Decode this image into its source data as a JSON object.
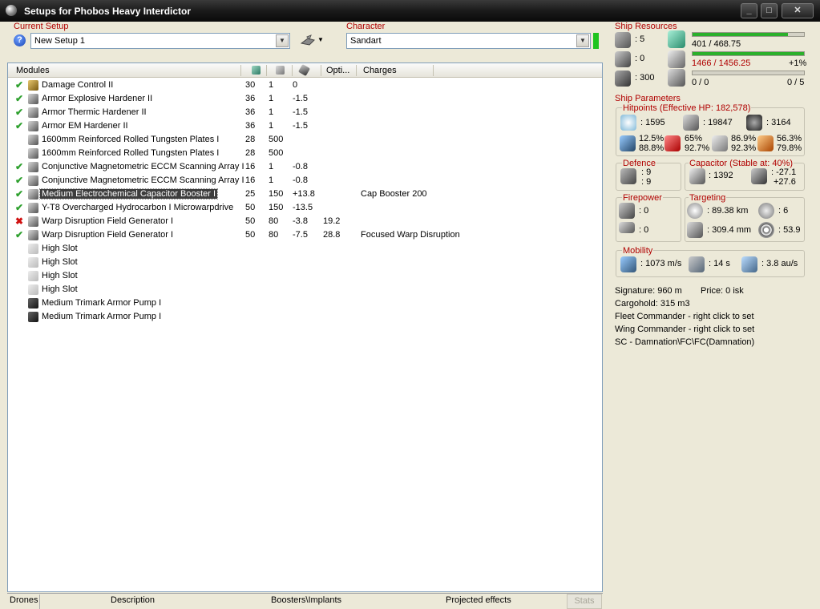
{
  "window": {
    "title": "Setups for Phobos Heavy Interdictor",
    "min_label": "_",
    "max_label": "□",
    "close_label": "✕"
  },
  "setup": {
    "label": "Current Setup",
    "value": "New Setup 1",
    "help_label": "?",
    "tool_arrow": "▼"
  },
  "character": {
    "label": "Character",
    "value": "Sandart",
    "status_color": "#1fc41f"
  },
  "modules_header": {
    "modules": "Modules",
    "opti": "Opti...",
    "charges": "Charges"
  },
  "modules": [
    {
      "status": "✔",
      "name": "Damage Control II",
      "cpu": "30",
      "pg": "1",
      "cap": "0",
      "opti": "",
      "charge": ""
    },
    {
      "status": "✔",
      "name": "Armor Explosive Hardener II",
      "cpu": "36",
      "pg": "1",
      "cap": "-1.5",
      "opti": "",
      "charge": ""
    },
    {
      "status": "✔",
      "name": "Armor Thermic Hardener II",
      "cpu": "36",
      "pg": "1",
      "cap": "-1.5",
      "opti": "",
      "charge": ""
    },
    {
      "status": "✔",
      "name": "Armor EM Hardener II",
      "cpu": "36",
      "pg": "1",
      "cap": "-1.5",
      "opti": "",
      "charge": ""
    },
    {
      "status": "",
      "name": "1600mm Reinforced Rolled Tungsten Plates I",
      "cpu": "28",
      "pg": "500",
      "cap": "",
      "opti": "",
      "charge": ""
    },
    {
      "status": "",
      "name": "1600mm Reinforced Rolled Tungsten Plates I",
      "cpu": "28",
      "pg": "500",
      "cap": "",
      "opti": "",
      "charge": ""
    },
    {
      "status": "✔",
      "name": "Conjunctive Magnetometric ECCM Scanning Array I",
      "cpu": "16",
      "pg": "1",
      "cap": "-0.8",
      "opti": "",
      "charge": ""
    },
    {
      "status": "✔",
      "name": "Conjunctive Magnetometric ECCM Scanning Array I",
      "cpu": "16",
      "pg": "1",
      "cap": "-0.8",
      "opti": "",
      "charge": ""
    },
    {
      "status": "✔",
      "name": "Medium Electrochemical Capacitor Booster I",
      "cpu": "25",
      "pg": "150",
      "cap": "+13.8",
      "opti": "",
      "charge": "Cap Booster 200"
    },
    {
      "status": "✔",
      "name": "Y-T8 Overcharged Hydrocarbon I Microwarpdrive",
      "cpu": "50",
      "pg": "150",
      "cap": "-13.5",
      "opti": "",
      "charge": ""
    },
    {
      "status": "✖",
      "name": "Warp Disruption Field Generator I",
      "cpu": "50",
      "pg": "80",
      "cap": "-3.8",
      "opti": "19.2",
      "charge": ""
    },
    {
      "status": "✔",
      "name": "Warp Disruption Field Generator I",
      "cpu": "50",
      "pg": "80",
      "cap": "-7.5",
      "opti": "28.8",
      "charge": "Focused Warp Disruption"
    },
    {
      "status": "",
      "name": "High Slot",
      "cpu": "",
      "pg": "",
      "cap": "",
      "opti": "",
      "charge": ""
    },
    {
      "status": "",
      "name": "High Slot",
      "cpu": "",
      "pg": "",
      "cap": "",
      "opti": "",
      "charge": ""
    },
    {
      "status": "",
      "name": "High Slot",
      "cpu": "",
      "pg": "",
      "cap": "",
      "opti": "",
      "charge": ""
    },
    {
      "status": "",
      "name": "High Slot",
      "cpu": "",
      "pg": "",
      "cap": "",
      "opti": "",
      "charge": ""
    },
    {
      "status": "",
      "name": "Medium Trimark Armor Pump I",
      "cpu": "",
      "pg": "",
      "cap": "",
      "opti": "",
      "charge": ""
    },
    {
      "status": "",
      "name": "Medium Trimark Armor Pump I",
      "cpu": "",
      "pg": "",
      "cap": "",
      "opti": "",
      "charge": ""
    }
  ],
  "bottom_tabs": {
    "drones": "Drones",
    "description": "Description",
    "boosters": "Boosters\\Implants",
    "projected": "Projected effects",
    "stats": "Stats"
  },
  "resources": {
    "label": "Ship Resources",
    "turret": ": 5",
    "launcher": ": 0",
    "calibration": ": 300",
    "cpu": "401 / 468.75",
    "cpu_fill": 0.855,
    "powergrid": "1466 / 1456.25",
    "powergrid_pct": "+1%",
    "powergrid_fill": 1.0,
    "drone_bay": "0 / 0",
    "drone_count": "0 / 5",
    "drone_fill": 0
  },
  "params": {
    "label": "Ship Parameters",
    "hitpoints_label": "Hitpoints (Effective HP: 182,578)",
    "shield_hp": ": 1595",
    "armor_hp": ": 19847",
    "structure_hp": ": 3164",
    "res_em_a": "12.5%",
    "res_em_b": "88.8%",
    "res_therm_a": "65%",
    "res_therm_b": "92.7%",
    "res_kin_a": "86.9%",
    "res_kin_b": "92.3%",
    "res_exp_a": "56.3%",
    "res_exp_b": "79.8%",
    "defence_label": "Defence",
    "defence_1": ": 9",
    "defence_2": ": 9",
    "capacitor_label": "Capacitor (Stable at: 40%)",
    "cap_amount": ": 1392",
    "cap_delta_1": ": -27.1",
    "cap_delta_2": "+27.6",
    "firepower_label": "Firepower",
    "firepower_1": ": 0",
    "firepower_2": ": 0",
    "targeting_label": "Targeting",
    "target_range": ": 89.38 km",
    "target_count": ": 6",
    "scan_res": ": 309.4 mm",
    "sensor_strength": ": 53.9",
    "mobility_label": "Mobility",
    "velocity": ": 1073 m/s",
    "align_time": ": 14 s",
    "warp_speed": ": 3.8 au/s"
  },
  "misc": {
    "signature": "Signature: 960 m",
    "price": "Price: 0 isk",
    "cargohold": "Cargohold: 315 m3",
    "fleet_commander": "Fleet Commander - right click to set",
    "wing_commander": "Wing Commander - right click to set",
    "implant_path": "SC - Damnation\\FC\\FC(Damnation)"
  }
}
